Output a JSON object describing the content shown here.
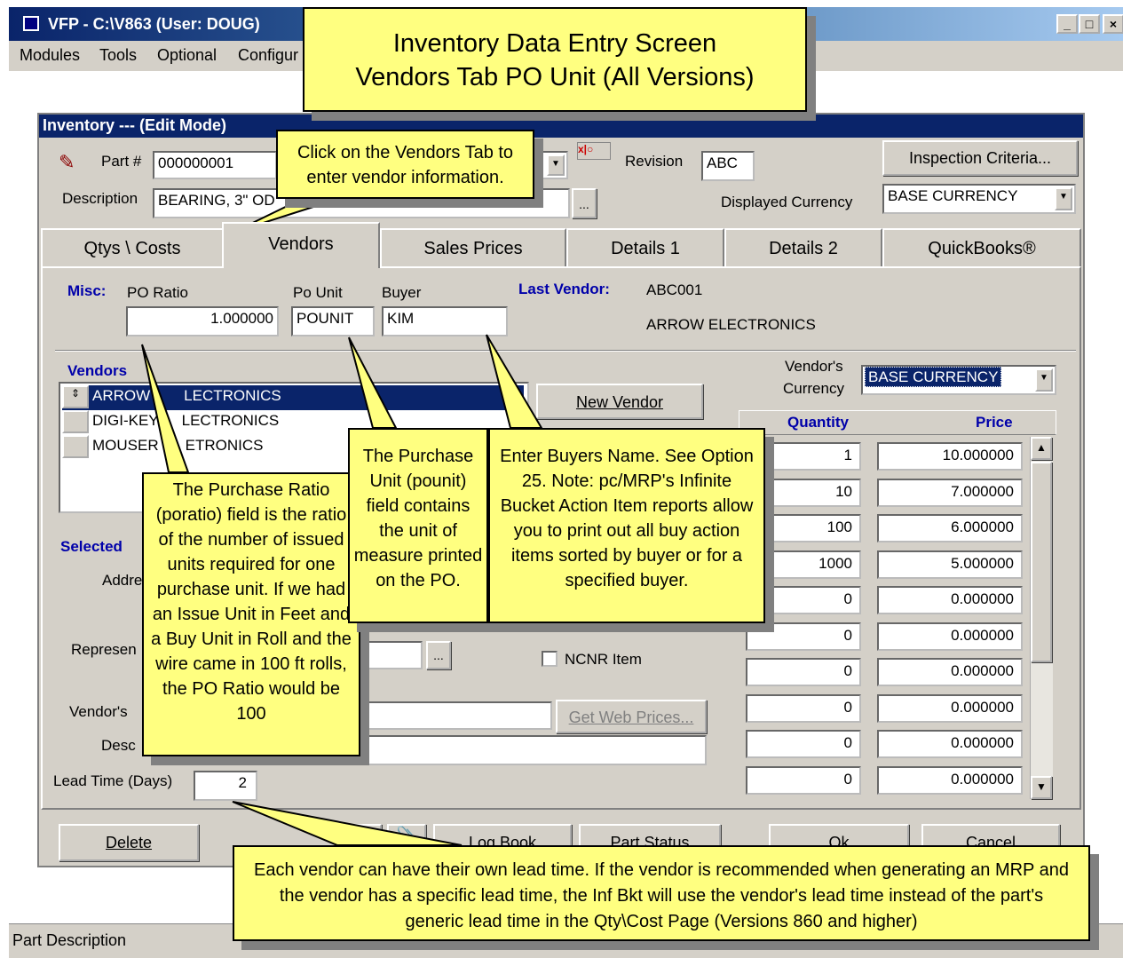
{
  "window": {
    "title": "VFP - C:\\V863  (User: DOUG)"
  },
  "menu": [
    "Modules",
    "Tools",
    "Optional",
    "Configur"
  ],
  "form": {
    "title": "Inventory --- (Edit Mode)",
    "part_label": "Part #",
    "part_value": "000000001",
    "description_label": "Description",
    "description_value": "BEARING, 3\" OD",
    "revision_label": "Revision",
    "revision_value": "ABC",
    "inspection_button": "Inspection Criteria...",
    "currency_label": "Displayed Currency",
    "currency_value": "BASE CURRENCY",
    "ellipsis": "..."
  },
  "tabs": [
    "Qtys \\ Costs",
    "Vendors",
    "Sales Prices",
    "Details 1",
    "Details 2",
    "QuickBooks®"
  ],
  "misc": {
    "label": "Misc:",
    "po_ratio_label": "PO Ratio",
    "po_ratio_value": "1.000000",
    "po_unit_label": "Po Unit",
    "po_unit_value": "POUNIT",
    "buyer_label": "Buyer",
    "buyer_value": "KIM",
    "last_vendor_label": "Last Vendor:",
    "last_vendor_code": "ABC001",
    "last_vendor_name": "ARROW ELECTRONICS"
  },
  "vendors": {
    "label": "Vendors",
    "rows": [
      "ARROW ELECTRONICS",
      "DIGI-KEY ELECTRONICS",
      "MOUSER ELECTRONICS"
    ],
    "visible_rows": [
      "ARROW",
      "LECTRONICS",
      "DIGI-KEY",
      "LECTRONICS",
      "MOUSER",
      "ETRONICS"
    ],
    "row_marker": "⇕",
    "new_vendor_button": "New Vendor",
    "selected_label": "Selected",
    "address_label": "Addre",
    "rep_label": "Represen",
    "vendor_pn_label": "Vendor's",
    "desc_label": "Desc",
    "lead_time_label": "Lead Time (Days)",
    "lead_time_value": "2",
    "ncnr_label": "NCNR Item",
    "web_prices_button": "Get Web Prices...",
    "vendor_currency_label_1": "Vendor's",
    "vendor_currency_label_2": "Currency",
    "vendor_currency_value": "BASE CURRENCY"
  },
  "price_breaks": {
    "qty_header": "Quantity",
    "price_header": "Price",
    "quantities": [
      "1",
      "10",
      "100",
      "1000",
      "0",
      "0",
      "0",
      "0",
      "0",
      "0"
    ],
    "prices": [
      "10.000000",
      "7.000000",
      "6.000000",
      "5.000000",
      "0.000000",
      "0.000000",
      "0.000000",
      "0.000000",
      "0.000000",
      "0.000000"
    ]
  },
  "bottom_buttons": [
    "Delete",
    "Log Book",
    "Part Status",
    "Ok",
    "Cancel"
  ],
  "status_text": "Part Description",
  "callouts": {
    "header_line1": "Inventory Data Entry Screen",
    "header_line2": "Vendors Tab PO Unit (All Versions)",
    "vendors_tab": "Click on the Vendors Tab to enter vendor information.",
    "po_ratio": "The Purchase Ratio (poratio) field is the ratio of the number of issued units required for one purchase unit. If we had an Issue Unit in Feet and a Buy Unit in Roll and the wire came in 100 ft rolls, the PO Ratio would be 100",
    "po_unit": "The Purchase Unit (pounit) field contains the unit of measure printed on the PO.",
    "buyer": "Enter Buyers Name.  See Option 25.  Note: pc/MRP's Infinite Bucket Action Item reports allow you to print out all buy action items sorted by buyer or for a specified buyer.",
    "lead_time": "Each vendor can have their own lead time.  If the vendor is recommended when generating an MRP and the vendor has a specific lead time, the Inf Bkt will use the vendor's lead time instead of the part's generic lead time in the Qty\\Cost Page (Versions 860 and higher)"
  },
  "colors": {
    "title_bar": "#0a246a",
    "callout": "#ffff80",
    "form_bg": "#d4d0c8",
    "label_blue": "#0000aa"
  }
}
